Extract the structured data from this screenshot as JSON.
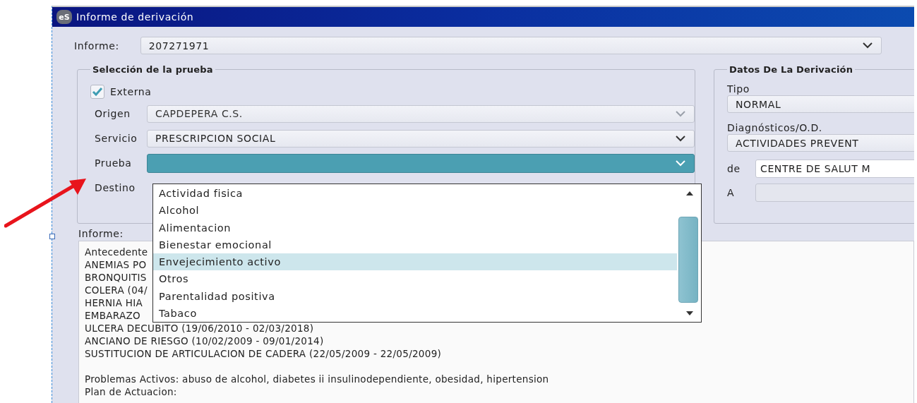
{
  "window": {
    "title": "Informe de derivación",
    "icon": "eS"
  },
  "informe": {
    "label": "Informe:",
    "value": "207271971"
  },
  "seleccion": {
    "title": "Selección de la prueba",
    "externa": {
      "label": "Externa",
      "checked": true
    },
    "fields": [
      {
        "label": "Origen",
        "kind": "combo",
        "value": "CAPDEPERA C.S.",
        "disabled": true,
        "focused": false
      },
      {
        "label": "Servicio",
        "kind": "combo",
        "value": "PRESCRIPCION SOCIAL",
        "disabled": false,
        "focused": false
      },
      {
        "label": "Prueba",
        "kind": "combo",
        "disabled": false,
        "focused": true
      },
      {
        "label": "Destino",
        "kind": "covered"
      }
    ]
  },
  "dropdown": {
    "items": [
      {
        "label": "Actividad fisica",
        "selected": false
      },
      {
        "label": "Alcohol",
        "selected": false
      },
      {
        "label": "Alimentacion",
        "selected": false
      },
      {
        "label": "Bienestar emocional",
        "selected": false
      },
      {
        "label": "Envejecimiento activo",
        "selected": true
      },
      {
        "label": "Otros",
        "selected": false
      },
      {
        "label": "Parentalidad positiva",
        "selected": false
      },
      {
        "label": "Tabaco",
        "selected": false
      }
    ]
  },
  "datos": {
    "title": "Datos De La Derivación",
    "tipo_label": "Tipo",
    "tipo": "NORMAL",
    "diagnosticos_label": "Diagnósticos/O.D.",
    "diagnosticos": "ACTIVIDADES PREVENT",
    "de_label": "de",
    "de": "CENTRE DE SALUT M",
    "a_label": "A"
  },
  "report": {
    "label": "Informe:",
    "paragraphs": [
      [
        "Antecedente",
        "ANEMIAS PO",
        "BRONQUITIS",
        "COLERA (04/",
        "HERNIA HIA",
        "EMBARAZO",
        "ULCERA DECUBITO (19/06/2010 - 02/03/2018)",
        "ANCIANO DE RIESGO (10/02/2009 - 09/01/2014)",
        "SUSTITUCION DE ARTICULACION DE CADERA (22/05/2009 - 22/05/2009)"
      ],
      [
        "Problemas Activos: abuso de alcohol, diabetes ii insulinodependiente, obesidad, hipertension",
        "Plan de Actuacion:"
      ]
    ]
  }
}
